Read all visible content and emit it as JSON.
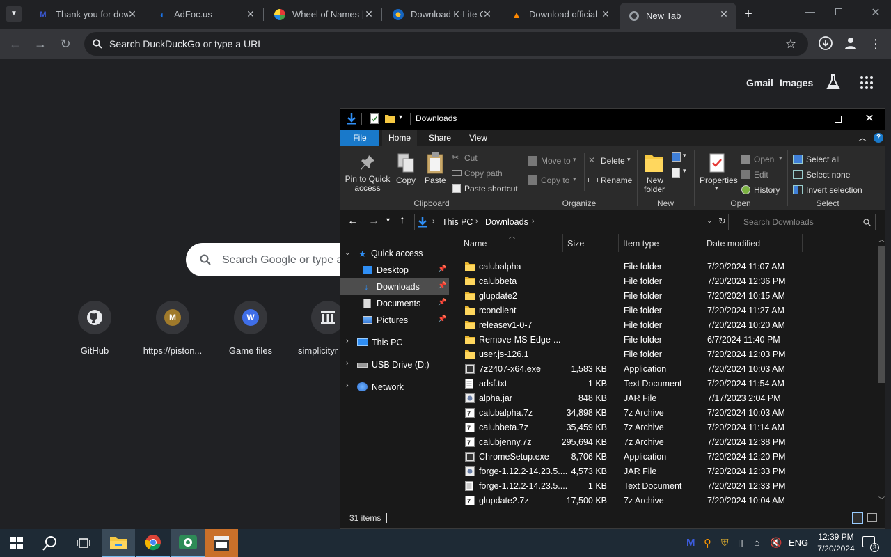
{
  "browser": {
    "tabs": [
      {
        "title": "Thank you for dow",
        "icon": "m-logo-icon",
        "color": "#3b5bdb"
      },
      {
        "title": "AdFoc.us",
        "icon": "adfocus-icon",
        "color": "#1a73e8"
      },
      {
        "title": "Wheel of Names |",
        "icon": "wheel-icon",
        "color": "#e53935"
      },
      {
        "title": "Download K-Lite C",
        "icon": "codec-icon",
        "color": "#fbc02d"
      },
      {
        "title": "Download official",
        "icon": "vlc-icon",
        "color": "#ff8800"
      },
      {
        "title": "New Tab",
        "icon": "chrome-icon",
        "color": "#9aa0a6"
      }
    ],
    "omnibox_text": "Search DuckDuckGo or type a URL"
  },
  "ntp": {
    "gmail": "Gmail",
    "images": "Images",
    "search_placeholder": "Search Google or type a",
    "shortcuts": [
      {
        "label": "GitHub",
        "letter": ""
      },
      {
        "label": "https://piston...",
        "letter": "M"
      },
      {
        "label": "Game files",
        "letter": "W"
      },
      {
        "label": "simplicityr",
        "letter": ""
      }
    ]
  },
  "explorer": {
    "title": "Downloads",
    "ribbon_tabs": [
      "File",
      "Home",
      "Share",
      "View"
    ],
    "clipboard": {
      "pin": "Pin to Quick access",
      "copy": "Copy",
      "paste": "Paste",
      "cut": "Cut",
      "copy_path": "Copy path",
      "paste_shortcut": "Paste shortcut",
      "group": "Clipboard"
    },
    "organize": {
      "move_to": "Move to",
      "copy_to": "Copy to",
      "delete": "Delete",
      "rename": "Rename",
      "group": "Organize"
    },
    "new": {
      "new_folder_l1": "New",
      "new_folder_l2": "folder",
      "group": "New"
    },
    "open": {
      "properties": "Properties",
      "open": "Open",
      "edit": "Edit",
      "history": "History",
      "group": "Open"
    },
    "select": {
      "select_all": "Select all",
      "select_none": "Select none",
      "invert": "Invert selection",
      "group": "Select"
    },
    "breadcrumb": [
      "This PC",
      "Downloads"
    ],
    "search_placeholder": "Search Downloads",
    "nav": {
      "quick_access": "Quick access",
      "desktop": "Desktop",
      "downloads": "Downloads",
      "documents": "Documents",
      "pictures": "Pictures",
      "this_pc": "This PC",
      "usb": "USB Drive (D:)",
      "network": "Network"
    },
    "columns": [
      "Name",
      "Size",
      "Item type",
      "Date modified"
    ],
    "files": [
      {
        "name": "calubalpha",
        "size": "",
        "type": "File folder",
        "date": "7/20/2024 11:07 AM",
        "kind": "folder"
      },
      {
        "name": "calubbeta",
        "size": "",
        "type": "File folder",
        "date": "7/20/2024 12:36 PM",
        "kind": "folder"
      },
      {
        "name": "glupdate2",
        "size": "",
        "type": "File folder",
        "date": "7/20/2024 10:15 AM",
        "kind": "folder"
      },
      {
        "name": "rconclient",
        "size": "",
        "type": "File folder",
        "date": "7/20/2024 11:27 AM",
        "kind": "folder"
      },
      {
        "name": "releasev1-0-7",
        "size": "",
        "type": "File folder",
        "date": "7/20/2024 10:20 AM",
        "kind": "folder"
      },
      {
        "name": "Remove-MS-Edge-...",
        "size": "",
        "type": "File folder",
        "date": "6/7/2024 11:40 PM",
        "kind": "folder"
      },
      {
        "name": "user.js-126.1",
        "size": "",
        "type": "File folder",
        "date": "7/20/2024 12:03 PM",
        "kind": "folder"
      },
      {
        "name": "7z2407-x64.exe",
        "size": "1,583 KB",
        "type": "Application",
        "date": "7/20/2024 10:03 AM",
        "kind": "app"
      },
      {
        "name": "adsf.txt",
        "size": "1 KB",
        "type": "Text Document",
        "date": "7/20/2024 11:54 AM",
        "kind": "txt"
      },
      {
        "name": "alpha.jar",
        "size": "848 KB",
        "type": "JAR File",
        "date": "7/17/2023 2:04 PM",
        "kind": "jar"
      },
      {
        "name": "calubalpha.7z",
        "size": "34,898 KB",
        "type": "7z Archive",
        "date": "7/20/2024 10:03 AM",
        "kind": "7z"
      },
      {
        "name": "calubbeta.7z",
        "size": "35,459 KB",
        "type": "7z Archive",
        "date": "7/20/2024 11:14 AM",
        "kind": "7z"
      },
      {
        "name": "calubjenny.7z",
        "size": "295,694 KB",
        "type": "7z Archive",
        "date": "7/20/2024 12:38 PM",
        "kind": "7z"
      },
      {
        "name": "ChromeSetup.exe",
        "size": "8,706 KB",
        "type": "Application",
        "date": "7/20/2024 12:20 PM",
        "kind": "app"
      },
      {
        "name": "forge-1.12.2-14.23.5....",
        "size": "4,573 KB",
        "type": "JAR File",
        "date": "7/20/2024 12:33 PM",
        "kind": "jar"
      },
      {
        "name": "forge-1.12.2-14.23.5....",
        "size": "1 KB",
        "type": "Text Document",
        "date": "7/20/2024 12:33 PM",
        "kind": "txt"
      },
      {
        "name": "glupdate2.7z",
        "size": "17,500 KB",
        "type": "7z Archive",
        "date": "7/20/2024 10:04 AM",
        "kind": "7z"
      }
    ],
    "status": "31 items"
  },
  "taskbar": {
    "lang": "ENG",
    "time": "12:39 PM",
    "date": "7/20/2024",
    "notifications": "3"
  }
}
